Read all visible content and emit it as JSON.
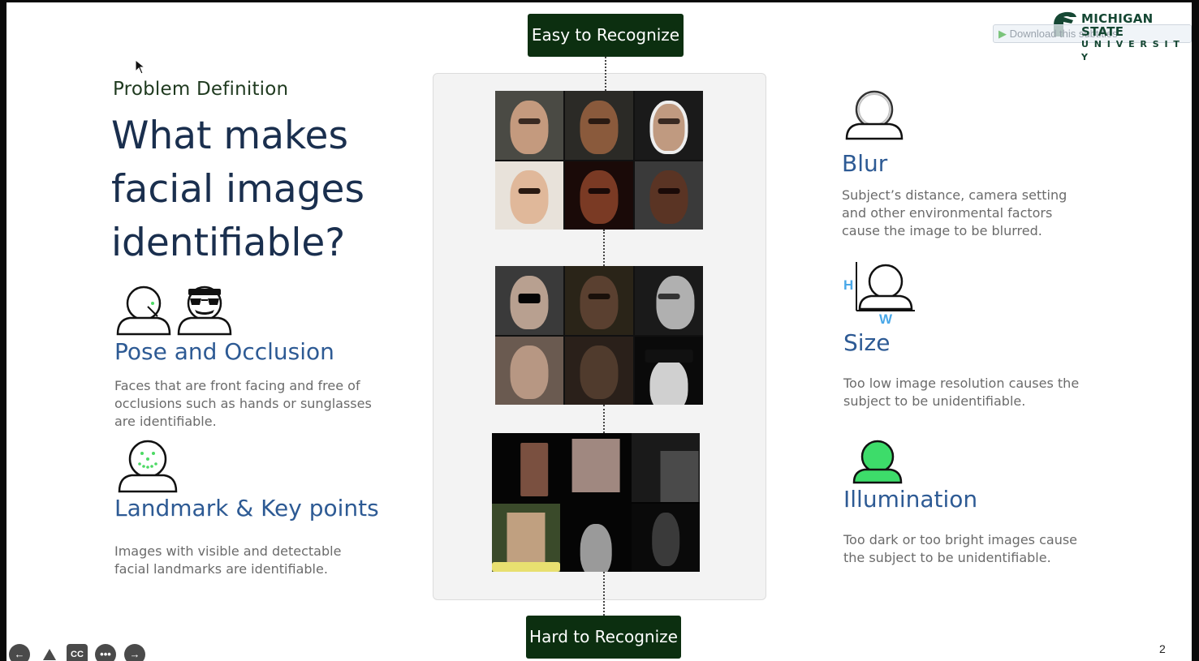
{
  "slide": {
    "section_label": "Problem Definition",
    "title": "What makes facial images identifiable?",
    "page_number": "2"
  },
  "logo": {
    "line1": "MICHIGAN STATE",
    "line2": "U N I V E R S I T Y"
  },
  "download_bar": {
    "label": "Download this subtitles"
  },
  "left_features": [
    {
      "title": "Pose and Occlusion",
      "desc": "Faces that are front facing and free of occlusions such as hands or sunglasses are identifiable.",
      "icon": "pose-occlusion-icon"
    },
    {
      "title": "Landmark & Key points",
      "desc": "Images with visible and detectable facial landmarks are identifiable.",
      "icon": "landmark-face-icon"
    }
  ],
  "right_features": [
    {
      "title": "Blur",
      "desc": "Subject’s distance, camera setting and other environmental factors cause the image to be blurred.",
      "icon": "blur-person-icon"
    },
    {
      "title": "Size",
      "desc": "Too low image resolution causes the subject to be unidentifiable.",
      "icon": "size-person-icon",
      "h_label": "H",
      "w_label": "W"
    },
    {
      "title": "Illumination",
      "desc": "Too dark or too bright images cause the subject to be unidentifiable.",
      "icon": "illumination-person-icon"
    }
  ],
  "scale": {
    "top_label": "Easy to Recognize",
    "bottom_label": "Hard to Recognize"
  },
  "colors": {
    "title_navy": "#1a2f4e",
    "feature_blue": "#2d5a94",
    "tag_green": "#0c2f10",
    "illumination_green": "#3ddc6a",
    "landmark_green": "#4cd964",
    "size_blue": "#4aa8e8"
  },
  "controls": {
    "cc_label": "CC"
  }
}
